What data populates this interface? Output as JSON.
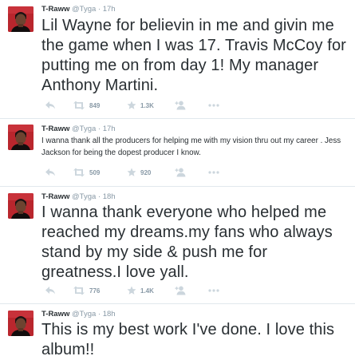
{
  "tweets": [
    {
      "name": "T-Raww",
      "handle": "@Tyga",
      "dot": "·",
      "time": "17h",
      "text": "Lil Wayne for believin in me and givin me the game when I was 17. Travis  McCoy for putting me on from day 1! My manager Anthony Martini.",
      "retweets": "849",
      "favorites": "1.3K"
    },
    {
      "name": "T-Raww",
      "handle": "@Tyga",
      "dot": "·",
      "time": "17h",
      "text": "I wanna thank all the producers for helping me with my vision thru out my career . Jess Jackson for being the dopest producer I know.",
      "retweets": "509",
      "favorites": "920"
    },
    {
      "name": "T-Raww",
      "handle": "@Tyga",
      "dot": "·",
      "time": "18h",
      "text": "I wanna thank everyone who helped me reached my dreams.my fans who always stand by my side & push me for greatness.I love yall.",
      "retweets": "776",
      "favorites": "1.4K"
    },
    {
      "name": "T-Raww",
      "handle": "@Tyga",
      "dot": "·",
      "time": "18h",
      "text": "This is my best work I've  done. I love this album!!"
    }
  ],
  "icons": {
    "reply": "reply-icon",
    "retweet": "retweet-icon",
    "favorite": "star-icon",
    "follow": "follow-icon",
    "more": "more-icon"
  },
  "colors": {
    "action_icon": "#ccd6dd",
    "meta_text": "#8899a6",
    "avatar_background": "#b9262d"
  }
}
